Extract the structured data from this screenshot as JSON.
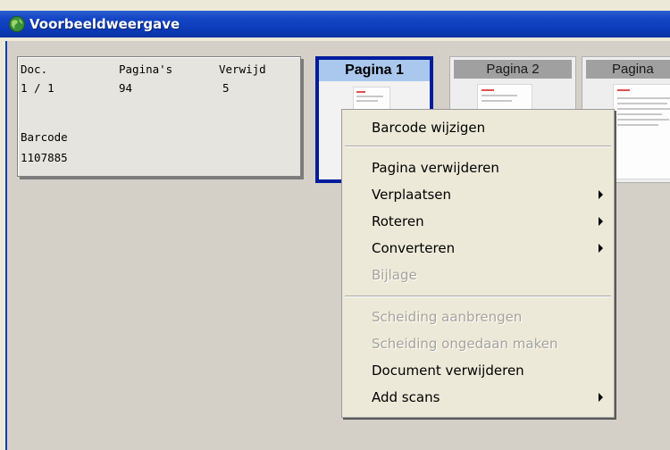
{
  "window": {
    "title": "Voorbeeldweergave",
    "icon": "app-globe-icon"
  },
  "doc_panel": {
    "doc_header": "Doc.",
    "pages_header": "Pagina's",
    "removed_header": "Verwijd",
    "doc_value": "1 / 1",
    "pages_value": "94",
    "removed_value": "5",
    "barcode_label": "Barcode",
    "barcode_value": "1107885"
  },
  "pages": [
    {
      "label": "Pagina 1",
      "selected": true
    },
    {
      "label": "Pagina 2",
      "selected": false
    },
    {
      "label": "Pagina",
      "selected": false
    }
  ],
  "context_menu": {
    "items": [
      {
        "label": "Barcode wijzigen",
        "enabled": true,
        "submenu": false
      },
      {
        "label": "Pagina verwijderen",
        "enabled": true,
        "submenu": false
      },
      {
        "label": "Verplaatsen",
        "enabled": true,
        "submenu": true
      },
      {
        "label": "Roteren",
        "enabled": true,
        "submenu": true
      },
      {
        "label": "Converteren",
        "enabled": true,
        "submenu": true
      },
      {
        "label": "Bijlage",
        "enabled": false,
        "submenu": false
      },
      {
        "label": "Scheiding aanbrengen",
        "enabled": false,
        "submenu": false
      },
      {
        "label": "Scheiding ongedaan maken",
        "enabled": false,
        "submenu": false
      },
      {
        "label": "Document verwijderen",
        "enabled": true,
        "submenu": false
      },
      {
        "label": "Add scans",
        "enabled": true,
        "submenu": true
      }
    ]
  },
  "colors": {
    "titlebar": "#0a3fb5",
    "selected_border": "#001c9c",
    "selected_header": "#aac8ee",
    "disabled_text": "#a6a39b"
  }
}
